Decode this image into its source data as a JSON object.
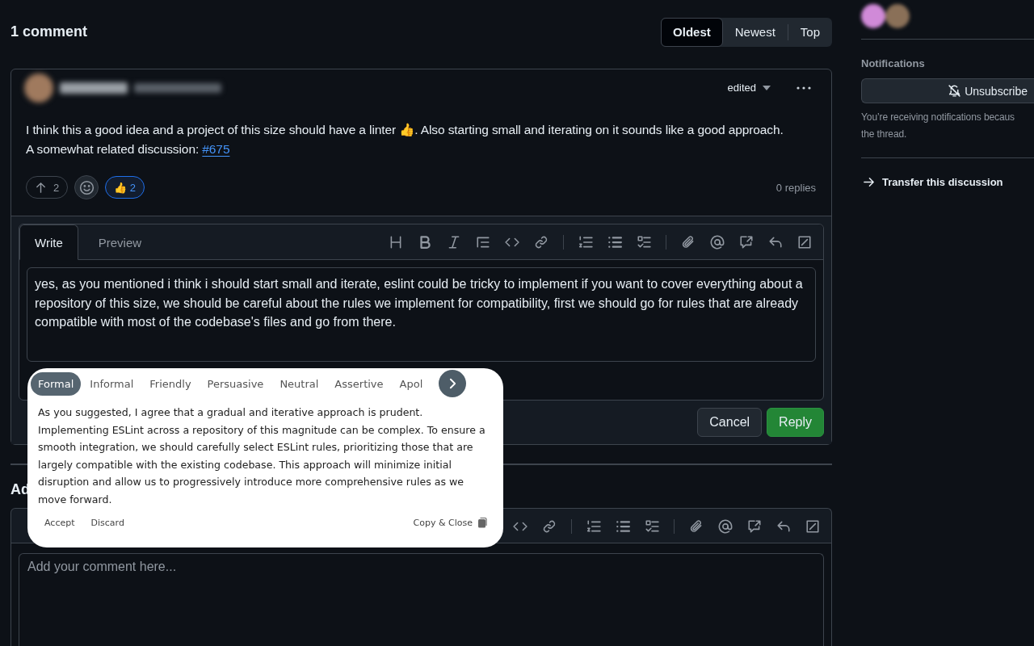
{
  "header": {
    "title": "1 comment",
    "sort_options": [
      {
        "label": "Oldest",
        "selected": true
      },
      {
        "label": "Newest",
        "selected": false
      },
      {
        "label": "Top",
        "selected": false
      }
    ]
  },
  "comment": {
    "edited_label": "edited",
    "body_line_1": "I think this a good idea and a project of this size should have a linter 👍. Also starting small and iterating on it sounds like a good approach.",
    "body_line_2": "A somewhat related discussion: ",
    "link": "#675",
    "reactions": [
      {
        "kind": "upvote",
        "count": "2",
        "selected": false
      },
      {
        "kind": "add_reaction"
      },
      {
        "kind": "emoji",
        "emoji": "👍",
        "count": "2",
        "selected": true
      }
    ],
    "replies": "0 replies"
  },
  "reply_editor": {
    "tabs": [
      {
        "label": "Write",
        "selected": true
      },
      {
        "label": "Preview",
        "selected": false
      }
    ],
    "value": "yes, as you mentioned i think i should start small and iterate, eslint could be tricky to implement if you want to cover everything about a repository of this size, we should be careful about the rules we implement for compatibility, first we should go for rules that are already compatible with most of the codebase's files and go from there.",
    "buttons": [
      {
        "label": "Cancel",
        "kind": "secondary"
      },
      {
        "label": "Reply",
        "kind": "primary"
      }
    ]
  },
  "tone_popup": {
    "tones": [
      {
        "label": "Formal",
        "selected": true
      },
      {
        "label": "Informal",
        "selected": false
      },
      {
        "label": "Friendly",
        "selected": false
      },
      {
        "label": "Persuasive",
        "selected": false
      },
      {
        "label": "Neutral",
        "selected": false
      },
      {
        "label": "Assertive",
        "selected": false
      },
      {
        "label": "Apol",
        "selected": false
      }
    ],
    "suggestion": "As you suggested, I agree that a gradual and iterative approach is prudent. Implementing ESLint across a repository of this magnitude can be complex. To ensure a smooth integration, we should carefully select ESLint rules, prioritizing those that are largely compatible with the existing codebase. This approach will minimize initial disruption and allow us to progressively introduce more comprehensive rules as we move forward.",
    "actions": [
      "Accept",
      "Discard"
    ],
    "copy_label": "Copy & Close"
  },
  "new_comment": {
    "heading": "Ad",
    "placeholder": "Add your comment here..."
  },
  "sidebar": {
    "notifications_title": "Notifications",
    "unsubscribe": "Unsubscribe",
    "notice_line_1": "You’re receiving notifications becaus",
    "notice_line_2": "the thread.",
    "transfer": "Transfer this discussion"
  }
}
